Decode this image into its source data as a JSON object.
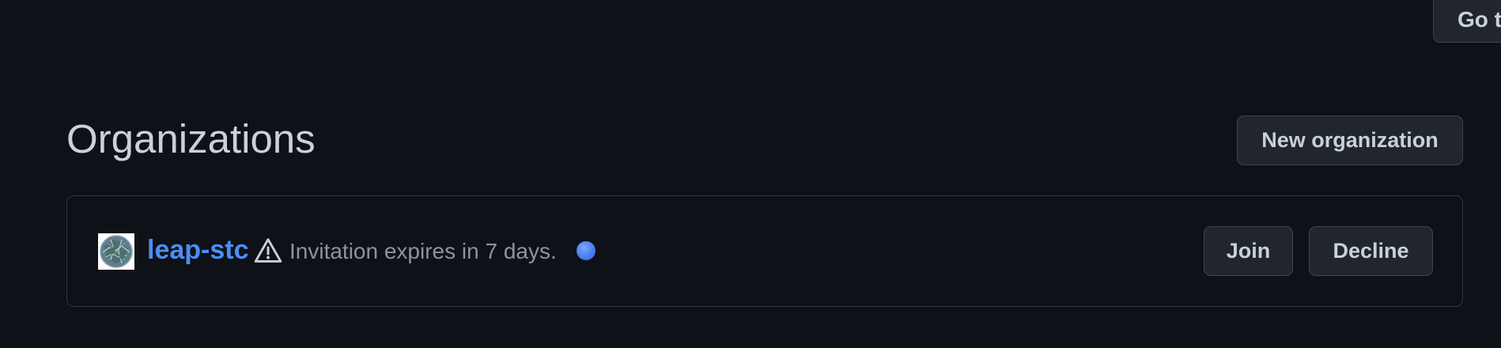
{
  "header": {
    "goto_label": "Go to"
  },
  "organizations": {
    "title": "Organizations",
    "new_button_label": "New organization",
    "items": [
      {
        "name": "leap-stc",
        "status_icon": "alert-icon",
        "invitation_text": "Invitation expires in 7 days.",
        "indicator_color": "#4a7ef0",
        "join_label": "Join",
        "decline_label": "Decline"
      }
    ]
  },
  "colors": {
    "background": "#0e1117",
    "link": "#4c8df6",
    "button_bg": "#21262d",
    "border": "#30363d"
  }
}
